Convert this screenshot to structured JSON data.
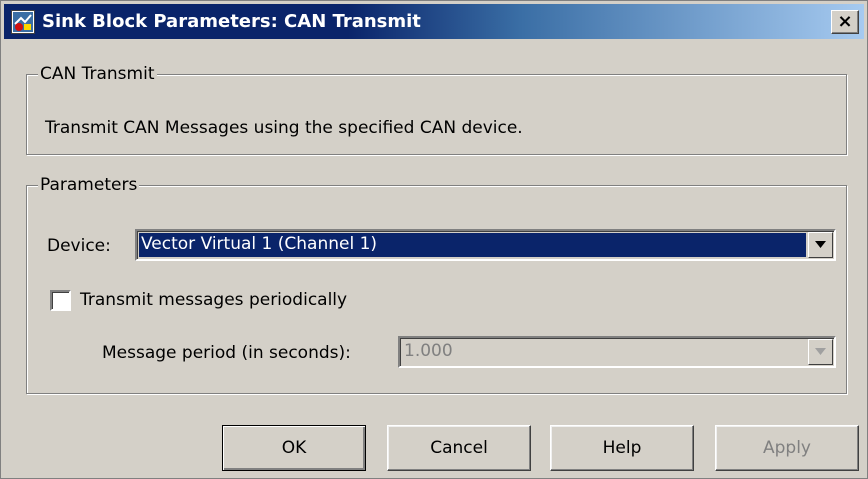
{
  "window": {
    "title": "Sink Block Parameters: CAN Transmit",
    "close_label": "×"
  },
  "description_group": {
    "legend": "CAN Transmit",
    "text": "Transmit CAN Messages using the specified CAN device."
  },
  "parameters_group": {
    "legend": "Parameters",
    "device_label": "Device:",
    "device_value": "Vector Virtual 1 (Channel 1)",
    "periodic_label": "Transmit messages periodically",
    "periodic_checked": false,
    "period_label": "Message period (in seconds):",
    "period_value": "1.000"
  },
  "buttons": {
    "ok": "OK",
    "cancel": "Cancel",
    "help": "Help",
    "apply": "Apply"
  },
  "colors": {
    "title_bar": "#0a246a",
    "selection": "#0a246a",
    "face": "#d4d0c8"
  },
  "icons": {
    "window": "simulink-block-icon",
    "dropdown": "chevron-down-icon"
  }
}
